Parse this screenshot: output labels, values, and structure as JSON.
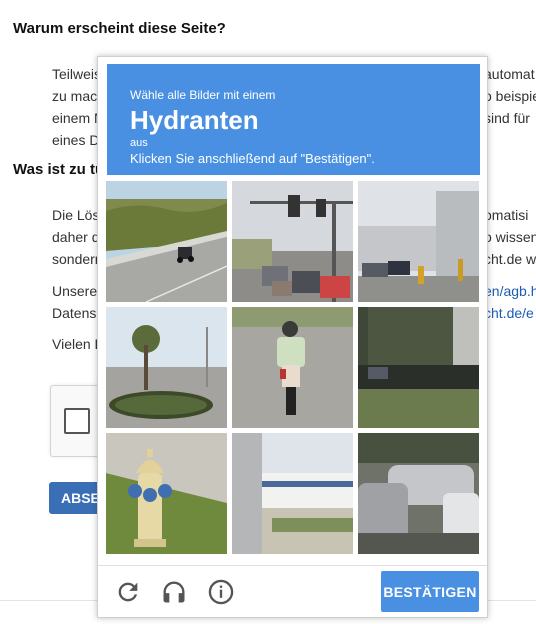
{
  "background": {
    "heading_why": "Warum erscheint diese Seite?",
    "para1": [
      "Teilweis",
      "zu mac",
      "einem N",
      "eines D"
    ],
    "para1_right": [
      "automat",
      "o beispie",
      "sind für"
    ],
    "heading_what": "Was ist zu tur",
    "para2": [
      "Die Lös",
      "daher d",
      "sondern"
    ],
    "para2_right": [
      "omatisi",
      "o wissen",
      "cht.de w"
    ],
    "para3": [
      "Unsere",
      "Datens"
    ],
    "para3_right_links": [
      "en/agb.h",
      "cht.de/e"
    ],
    "para4": "Vielen D",
    "button_label": "ABSEN"
  },
  "challenge": {
    "instruction_small": "Wähle alle Bilder mit einem",
    "target_word": "Hydranten",
    "aus_label": "aus",
    "confirm_instruction": "Klicken Sie anschließend auf \"Bestätigen\".",
    "tiles": [
      {
        "name": "tile-road-motorcycle"
      },
      {
        "name": "tile-traffic-light-street"
      },
      {
        "name": "tile-warehouse-cars"
      },
      {
        "name": "tile-tree-roundabout"
      },
      {
        "name": "tile-scooter-rider"
      },
      {
        "name": "tile-dark-parking"
      },
      {
        "name": "tile-fire-hydrant"
      },
      {
        "name": "tile-pole-building"
      },
      {
        "name": "tile-parked-cars"
      }
    ],
    "icons": [
      "reload-icon",
      "headphones-icon",
      "info-icon"
    ],
    "verify_label": "BESTÄTIGEN",
    "colors": {
      "accent": "#4a90e2",
      "background_button": "#3a6fb6"
    }
  }
}
